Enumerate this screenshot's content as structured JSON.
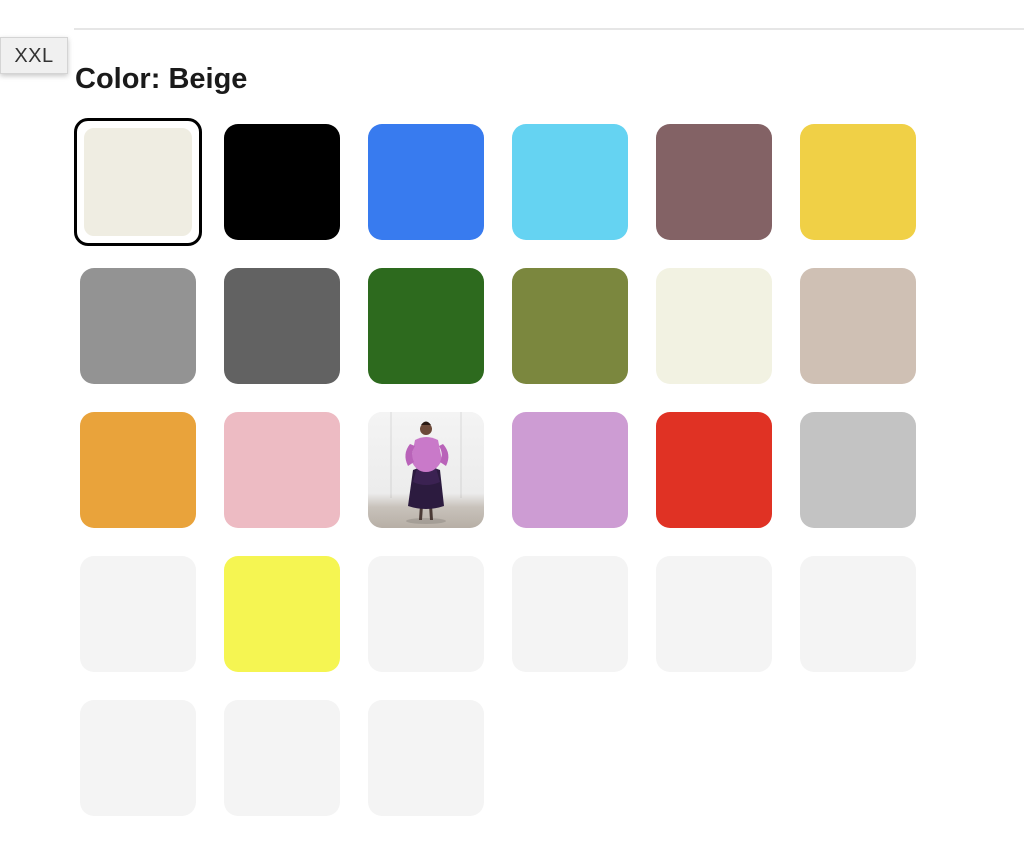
{
  "tooltip": {
    "size_label": "XXL"
  },
  "color_picker": {
    "heading_prefix": "Color: ",
    "selected_color": "Beige",
    "swatches": [
      {
        "color": "#efede2",
        "selected": true
      },
      {
        "color": "#000000"
      },
      {
        "color": "#387bef"
      },
      {
        "color": "#65d3f2"
      },
      {
        "color": "#836265"
      },
      {
        "color": "#f0d046"
      },
      {
        "color": "#939393"
      },
      {
        "color": "#626262"
      },
      {
        "color": "#2d6a1e"
      },
      {
        "color": "#7b873e"
      },
      {
        "color": "#f2f2e2"
      },
      {
        "color": "#cfc0b4"
      },
      {
        "color": "#e9a33b"
      },
      {
        "color": "#edbbc3"
      },
      {
        "image": "photo-purple-outfit"
      },
      {
        "color": "#cd9cd3"
      },
      {
        "color": "#e03224"
      },
      {
        "color": "#c3c3c3"
      },
      {
        "color": "#f4f4f4"
      },
      {
        "color": "#f5f552"
      },
      {
        "color": "#f4f4f4"
      },
      {
        "color": "#f4f4f4"
      },
      {
        "color": "#f4f4f4"
      },
      {
        "color": "#f4f4f4"
      },
      {
        "color": "#f4f4f4"
      },
      {
        "color": "#f4f4f4"
      },
      {
        "color": "#f4f4f4"
      }
    ]
  }
}
